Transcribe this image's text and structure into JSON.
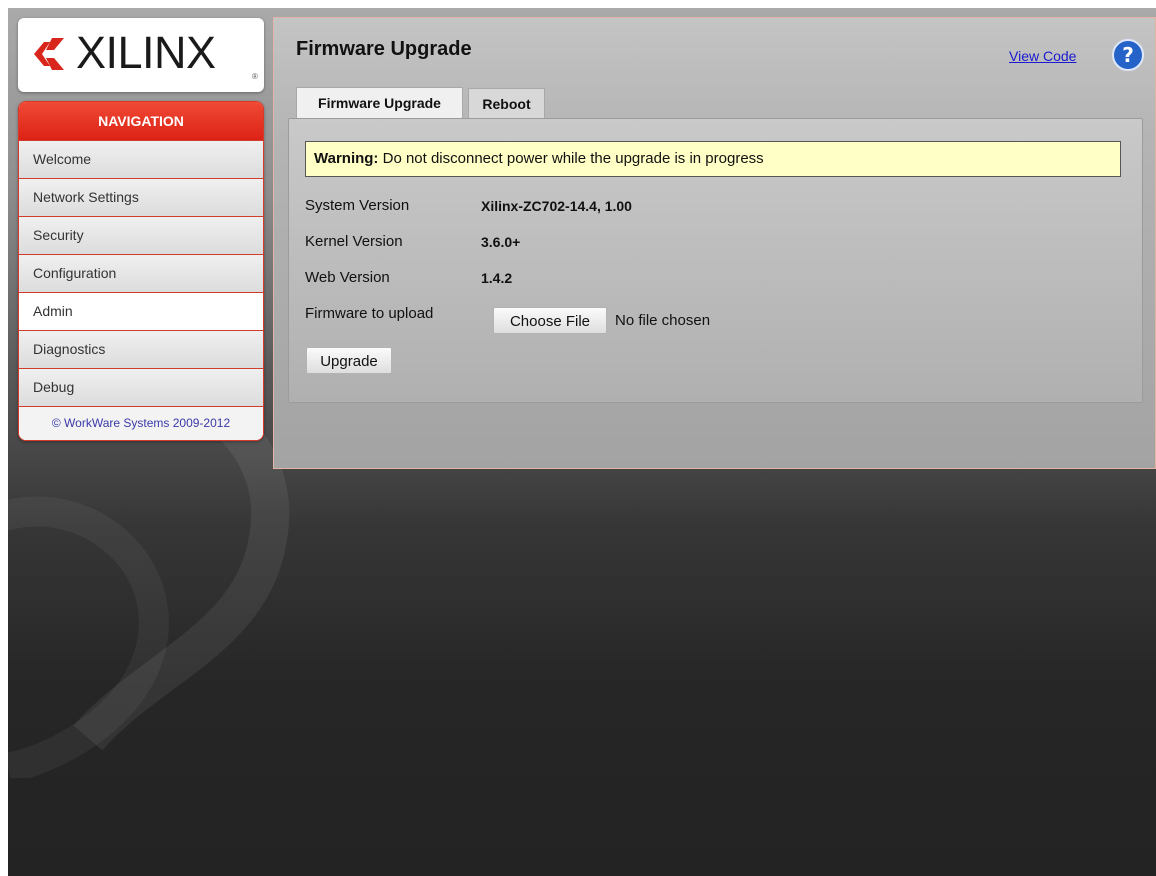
{
  "brand": {
    "logo_text": "XILINX",
    "logo_registered": "®",
    "logo_icon": "xilinx-logo-icon",
    "accent_color": "#dc2216"
  },
  "navigation": {
    "header": "NAVIGATION",
    "items": [
      {
        "label": "Welcome",
        "active": false
      },
      {
        "label": "Network Settings",
        "active": false
      },
      {
        "label": "Security",
        "active": false
      },
      {
        "label": "Configuration",
        "active": false
      },
      {
        "label": "Admin",
        "active": true
      },
      {
        "label": "Diagnostics",
        "active": false
      },
      {
        "label": "Debug",
        "active": false
      }
    ],
    "footer": "© WorkWare Systems 2009-2012"
  },
  "main": {
    "title": "Firmware Upgrade",
    "view_code_link": "View Code",
    "help_icon": "help-question-icon",
    "tabs": [
      {
        "label": "Firmware Upgrade",
        "active": true
      },
      {
        "label": "Reboot",
        "active": false
      }
    ],
    "warning": {
      "label": "Warning:",
      "text": " Do not disconnect power while the upgrade is in progress"
    },
    "fields": [
      {
        "label": "System Version",
        "value": "Xilinx-ZC702-14.4, 1.00"
      },
      {
        "label": "Kernel Version",
        "value": "3.6.0+"
      },
      {
        "label": "Web Version",
        "value": "1.4.2"
      }
    ],
    "upload": {
      "label": "Firmware to upload",
      "button": "Choose File",
      "status": "No file chosen"
    },
    "upgrade_button": "Upgrade"
  }
}
